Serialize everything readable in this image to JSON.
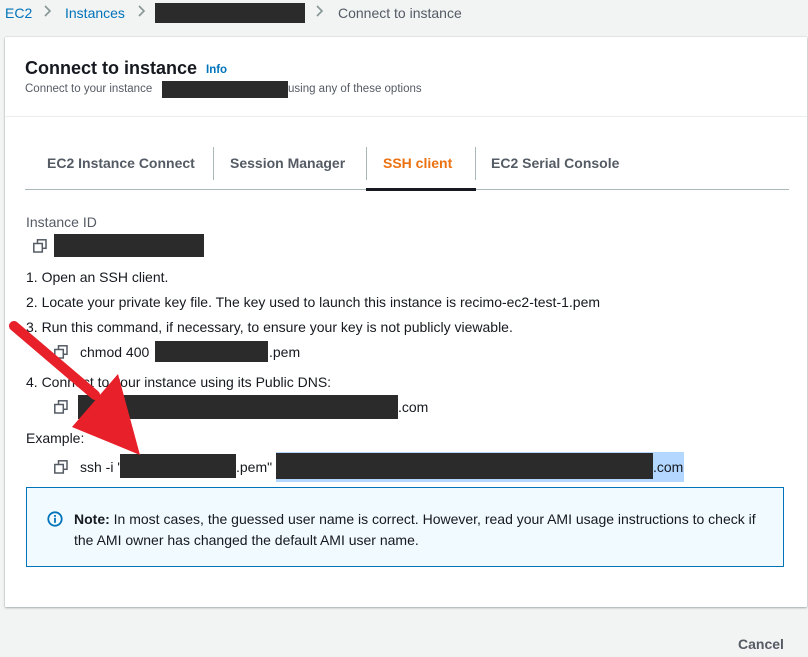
{
  "breadcrumb": {
    "ec2": "EC2",
    "instances": "Instances",
    "current": "Connect to instance"
  },
  "header": {
    "title": "Connect to instance",
    "info": "Info",
    "subtitle_before": "Connect to your instance",
    "subtitle_after": "using any of these options"
  },
  "tabs": [
    {
      "label": "EC2 Instance Connect"
    },
    {
      "label": "Session Manager"
    },
    {
      "label": "SSH client"
    },
    {
      "label": "EC2 Serial Console"
    }
  ],
  "instance": {
    "label": "Instance ID"
  },
  "steps": {
    "s1": "1. Open an SSH client.",
    "s2": "2. Locate your private key file. The key used to launch this instance is recimo-ec2-test-1.pem",
    "s3": "3. Run this command, if necessary, to ensure your key is not publicly viewable.",
    "s3_cmd_before": "chmod 400",
    "s3_cmd_after": ".pem",
    "s4": "4. Connect to your instance using its Public DNS:",
    "s4_after": ".com"
  },
  "example": {
    "label": "Example:",
    "cmd_before": "ssh -i \"",
    "cmd_mid": ".pem\"",
    "cmd_after": ".com"
  },
  "alert": {
    "bold": "Note:",
    "text": " In most cases, the guessed user name is correct. However, read your AMI usage instructions to check if the AMI owner has changed the default AMI user name."
  },
  "footer": {
    "cancel": "Cancel"
  },
  "icons": {
    "copy": "copy-icon",
    "info": "info-circle-icon",
    "chevron": "chevron-right-icon",
    "annotation": "red-arrow-annotation"
  },
  "colors": {
    "link": "#0073bb",
    "active_tab": "#ec7211",
    "alert_bg": "#f1faff",
    "alert_border": "#0073bb",
    "annotation_arrow": "#e8202a",
    "selection": "#b3d7ff"
  }
}
